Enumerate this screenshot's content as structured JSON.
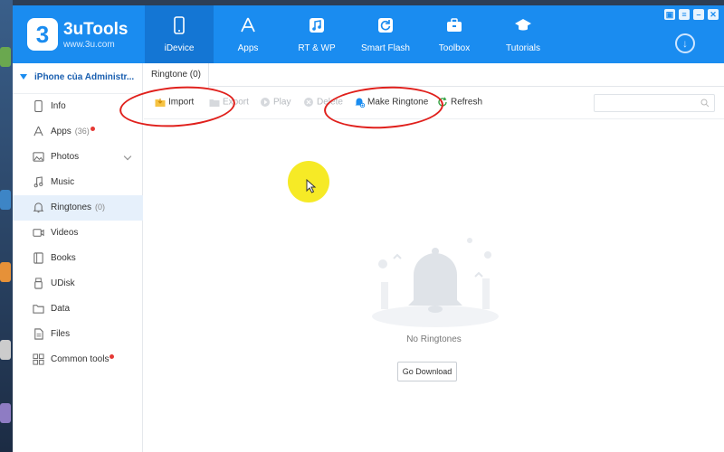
{
  "app": {
    "name": "3uTools",
    "url": "www.3u.com",
    "logo_glyph": "3"
  },
  "nav": [
    {
      "id": "idevice",
      "label": "iDevice",
      "icon": "phone-icon",
      "active": true
    },
    {
      "id": "apps",
      "label": "Apps",
      "icon": "app-store-icon",
      "active": false
    },
    {
      "id": "rtwp",
      "label": "RT & WP",
      "icon": "music-note-icon",
      "active": false
    },
    {
      "id": "smartflash",
      "label": "Smart Flash",
      "icon": "refresh-box-icon",
      "active": false
    },
    {
      "id": "toolbox",
      "label": "Toolbox",
      "icon": "toolbox-icon",
      "active": false
    },
    {
      "id": "tutorials",
      "label": "Tutorials",
      "icon": "graduation-cap-icon",
      "active": false
    }
  ],
  "window_controls": {
    "skin": "▣",
    "menu": "≡",
    "minimize": "–",
    "close": "✕"
  },
  "download_glyph": "↓",
  "sidebar": {
    "device_name": "iPhone của Administr...",
    "items": [
      {
        "id": "info",
        "label": "Info",
        "icon": "phone-outline-icon",
        "count": "",
        "dot": false,
        "active": false,
        "chevron": false
      },
      {
        "id": "apps",
        "label": "Apps",
        "icon": "app-store-outline-icon",
        "count": "(36)",
        "dot": true,
        "active": false,
        "chevron": false
      },
      {
        "id": "photos",
        "label": "Photos",
        "icon": "image-icon",
        "count": "",
        "dot": false,
        "active": false,
        "chevron": true
      },
      {
        "id": "music",
        "label": "Music",
        "icon": "music-icon",
        "count": "",
        "dot": false,
        "active": false,
        "chevron": false
      },
      {
        "id": "ringtones",
        "label": "Ringtones",
        "icon": "bell-icon",
        "count": "(0)",
        "dot": false,
        "active": true,
        "chevron": false
      },
      {
        "id": "videos",
        "label": "Videos",
        "icon": "video-icon",
        "count": "",
        "dot": false,
        "active": false,
        "chevron": false
      },
      {
        "id": "books",
        "label": "Books",
        "icon": "book-icon",
        "count": "",
        "dot": false,
        "active": false,
        "chevron": false
      },
      {
        "id": "udisk",
        "label": "UDisk",
        "icon": "usb-icon",
        "count": "",
        "dot": false,
        "active": false,
        "chevron": false
      },
      {
        "id": "data",
        "label": "Data",
        "icon": "folder-icon",
        "count": "",
        "dot": false,
        "active": false,
        "chevron": false
      },
      {
        "id": "files",
        "label": "Files",
        "icon": "file-icon",
        "count": "",
        "dot": false,
        "active": false,
        "chevron": false
      },
      {
        "id": "common_tools",
        "label": "Common tools",
        "icon": "grid-icon",
        "count": "",
        "dot": true,
        "active": false,
        "chevron": false
      }
    ]
  },
  "main": {
    "tab_label": "Ringtone (0)",
    "toolbar": {
      "import": "Import",
      "export": "Export",
      "play": "Play",
      "delete": "Delete",
      "make_ringtone": "Make Ringtone",
      "refresh": "Refresh"
    },
    "search_placeholder": "",
    "empty_text": "No Ringtones",
    "go_download": "Go Download"
  },
  "colors": {
    "header_blue": "#1a8cf0",
    "active_nav": "#1476d4",
    "sidebar_active": "#e6f0fb",
    "annotation_red": "#e0201c",
    "cursor_highlight": "#f5e600"
  }
}
